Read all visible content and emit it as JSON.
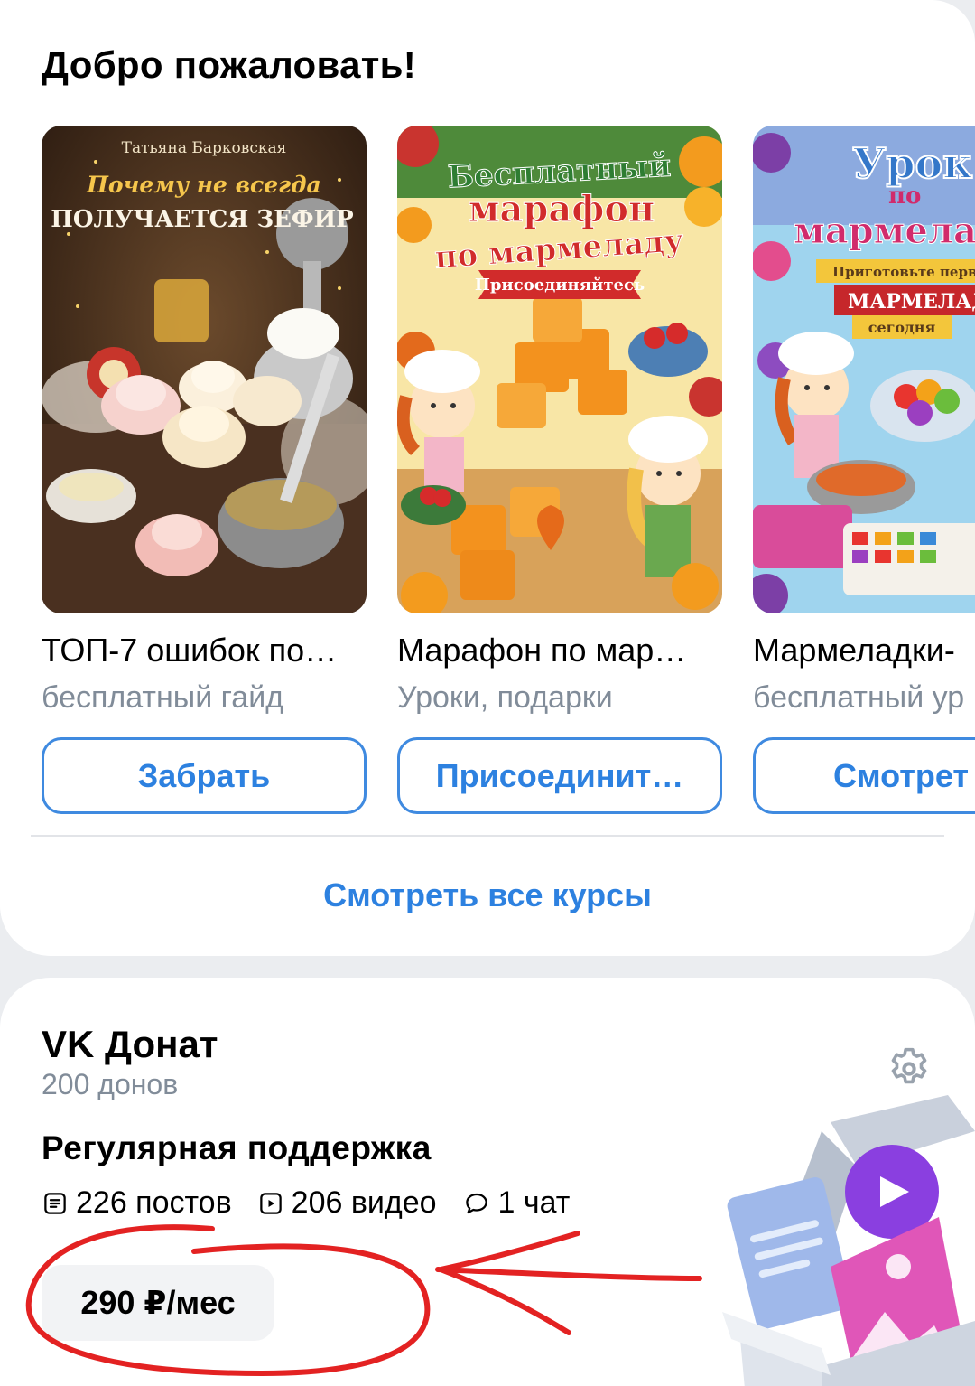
{
  "welcome": {
    "title": "Добро пожаловать!"
  },
  "courses": [
    {
      "cover_author": "Татьяна Барковская",
      "cover_line1": "Почему не всегда",
      "cover_line2": "ПОЛУЧАЕТСЯ ЗЕФИР",
      "title": "ТОП-7 ошибок по…",
      "subtitle": "бесплатный гайд",
      "button": "Забрать"
    },
    {
      "cover_line1": "Бесплатный",
      "cover_line2": "марафон",
      "cover_line3": "по мармеладу",
      "cover_ribbon": "Присоединяйтесь",
      "title": "Марафон по мар…",
      "subtitle": "Уроки, подарки",
      "button": "Присоединит…"
    },
    {
      "cover_line1": "Урок",
      "cover_line2": "по",
      "cover_line3": "мармела",
      "cover_ribbon1": "Приготовьте перв",
      "cover_ribbon2": "МАРМЕЛАД",
      "cover_ribbon3": "сегодня",
      "title": "Мармеладки-",
      "subtitle": "бесплатный ур",
      "button": "Смотрет"
    }
  ],
  "see_all": "Смотреть все курсы",
  "donut": {
    "title": "VK Донат",
    "count": "200 донов",
    "support": "Регулярная поддержка",
    "posts": "226 постов",
    "videos": "206 видео",
    "chats": "1 чат",
    "price": "290 ₽/мес"
  },
  "icons": [
    "gear-icon",
    "posts-icon",
    "video-icon",
    "chat-icon",
    "gift-box-icon"
  ],
  "colors": {
    "accent": "#2d81e0",
    "secondary_text": "#818c99",
    "annotation": "#e32222"
  }
}
